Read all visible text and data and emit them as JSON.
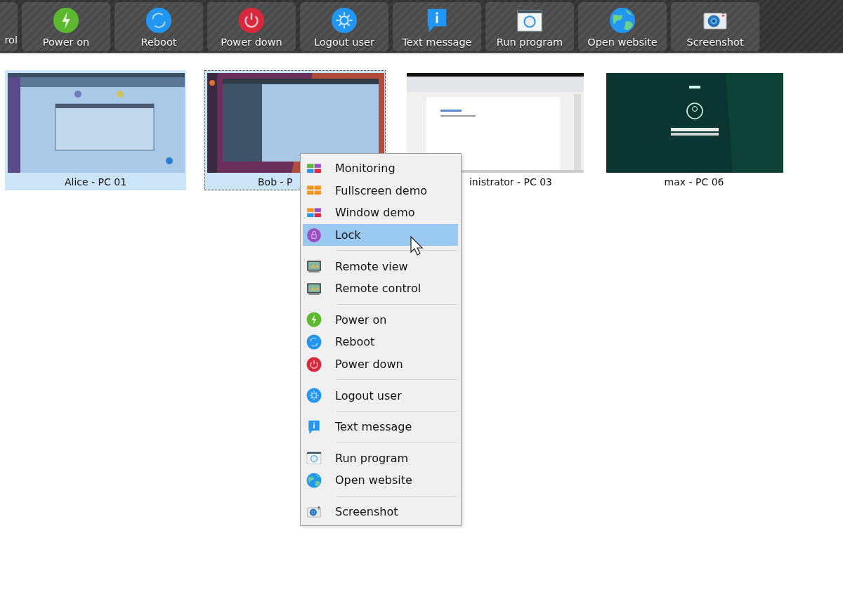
{
  "toolbar": {
    "buttons": [
      {
        "label": "rol",
        "kind": "partial"
      },
      {
        "label": "Power on",
        "kind": "full"
      },
      {
        "label": "Reboot",
        "kind": "full"
      },
      {
        "label": "Power down",
        "kind": "full"
      },
      {
        "label": "Logout user",
        "kind": "full"
      },
      {
        "label": "Text message",
        "kind": "full"
      },
      {
        "label": "Run program",
        "kind": "full"
      },
      {
        "label": "Open website",
        "kind": "full"
      },
      {
        "label": "Screenshot",
        "kind": "full"
      }
    ]
  },
  "computers": [
    {
      "label": "Alice - PC 01",
      "selected": true,
      "focused": false
    },
    {
      "label": "Bob - P",
      "selected": true,
      "focused": true
    },
    {
      "label": "inistrator - PC 03",
      "selected": false,
      "focused": false
    },
    {
      "label": "max - PC 06",
      "selected": false,
      "focused": false
    }
  ],
  "context_menu": {
    "groups": [
      [
        {
          "label": "Monitoring",
          "selected": false
        },
        {
          "label": "Fullscreen demo",
          "selected": false
        },
        {
          "label": "Window demo",
          "selected": false
        },
        {
          "label": "Lock",
          "selected": true
        }
      ],
      [
        {
          "label": "Remote view",
          "selected": false
        },
        {
          "label": "Remote control",
          "selected": false
        }
      ],
      [
        {
          "label": "Power on",
          "selected": false
        },
        {
          "label": "Reboot",
          "selected": false
        },
        {
          "label": "Power down",
          "selected": false
        }
      ],
      [
        {
          "label": "Logout user",
          "selected": false
        }
      ],
      [
        {
          "label": "Text message",
          "selected": false
        }
      ],
      [
        {
          "label": "Run program",
          "selected": false
        },
        {
          "label": "Open website",
          "selected": false
        }
      ],
      [
        {
          "label": "Screenshot",
          "selected": false
        }
      ]
    ]
  }
}
